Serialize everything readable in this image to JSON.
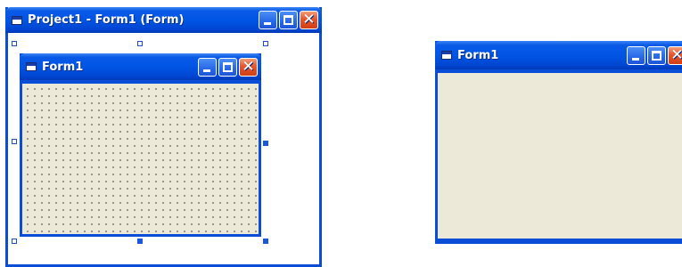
{
  "designer_window": {
    "title": "Project1 - Form1 (Form)"
  },
  "design_form": {
    "title": "Form1",
    "show_grid": true
  },
  "runtime_form": {
    "title": "Form1"
  },
  "icons": {
    "minimize": "minimize-icon",
    "maximize": "maximize-icon",
    "close": "close-icon",
    "app": "form-app-icon"
  },
  "colors": {
    "titlebar": "#0055e5",
    "client_area": "#ece9d8",
    "close_button": "#e5562a",
    "selection_handle": "#1a56e0"
  }
}
